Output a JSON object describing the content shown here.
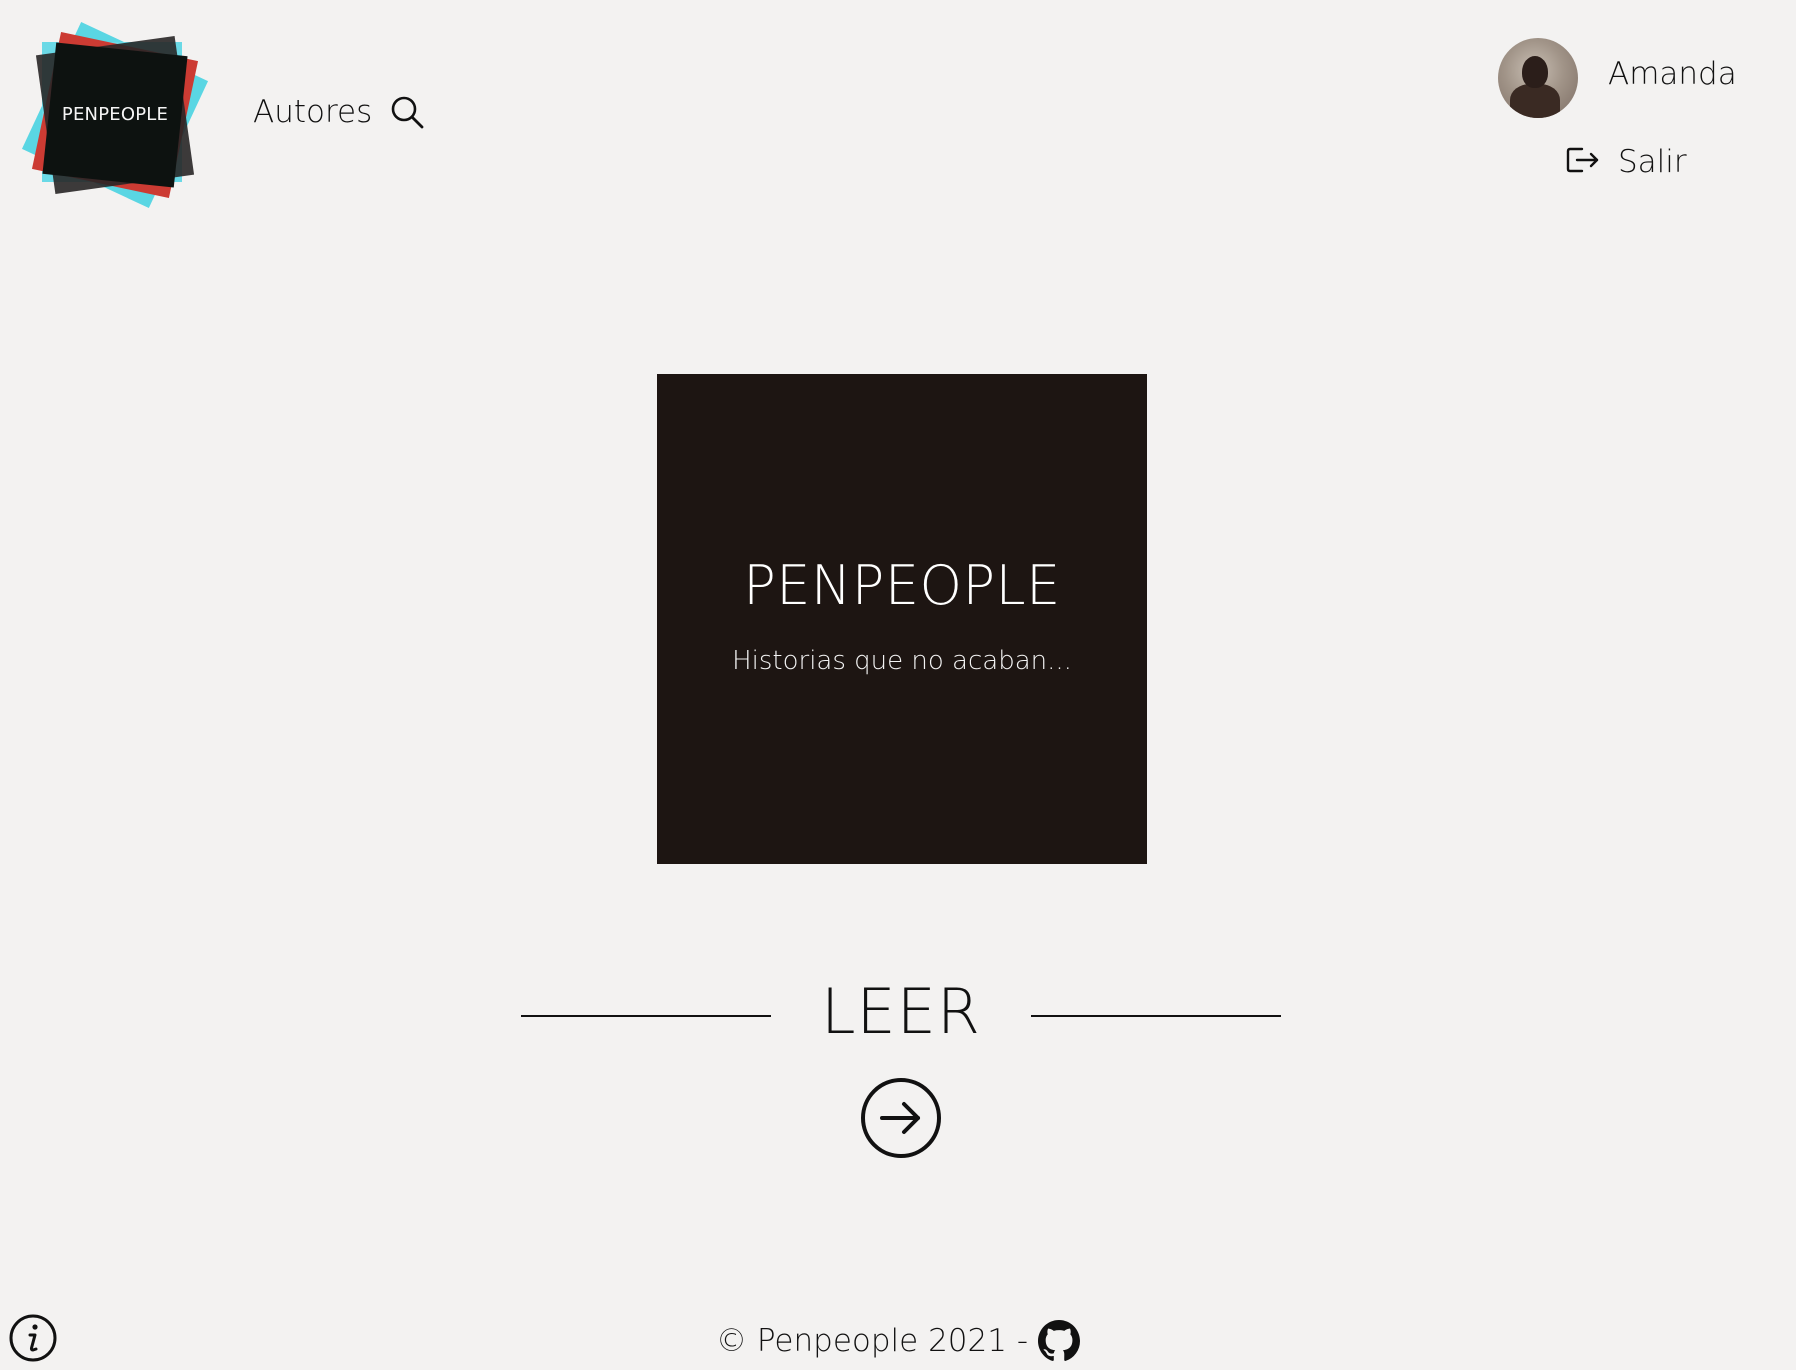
{
  "header": {
    "logo_text": "PENPEOPLE",
    "nav": {
      "authors_label": "Autores"
    },
    "user": {
      "name": "Amanda",
      "logout_label": "Salir"
    }
  },
  "hero": {
    "title": "PENPEOPLE",
    "subtitle": "Historias que no acaban..."
  },
  "read": {
    "label": "LEER"
  },
  "footer": {
    "copyright": "© Penpeople 2021 -"
  },
  "colors": {
    "background": "#f3f2f1",
    "hero_background": "#1d1512",
    "logo_cyan": "#5ad6e3",
    "logo_red": "#cc3b33",
    "text": "#111111"
  },
  "icons": {
    "search": "search-icon",
    "logout": "logout-icon",
    "read": "arrow-right-circle-icon",
    "info": "info-icon",
    "github": "github-icon"
  }
}
